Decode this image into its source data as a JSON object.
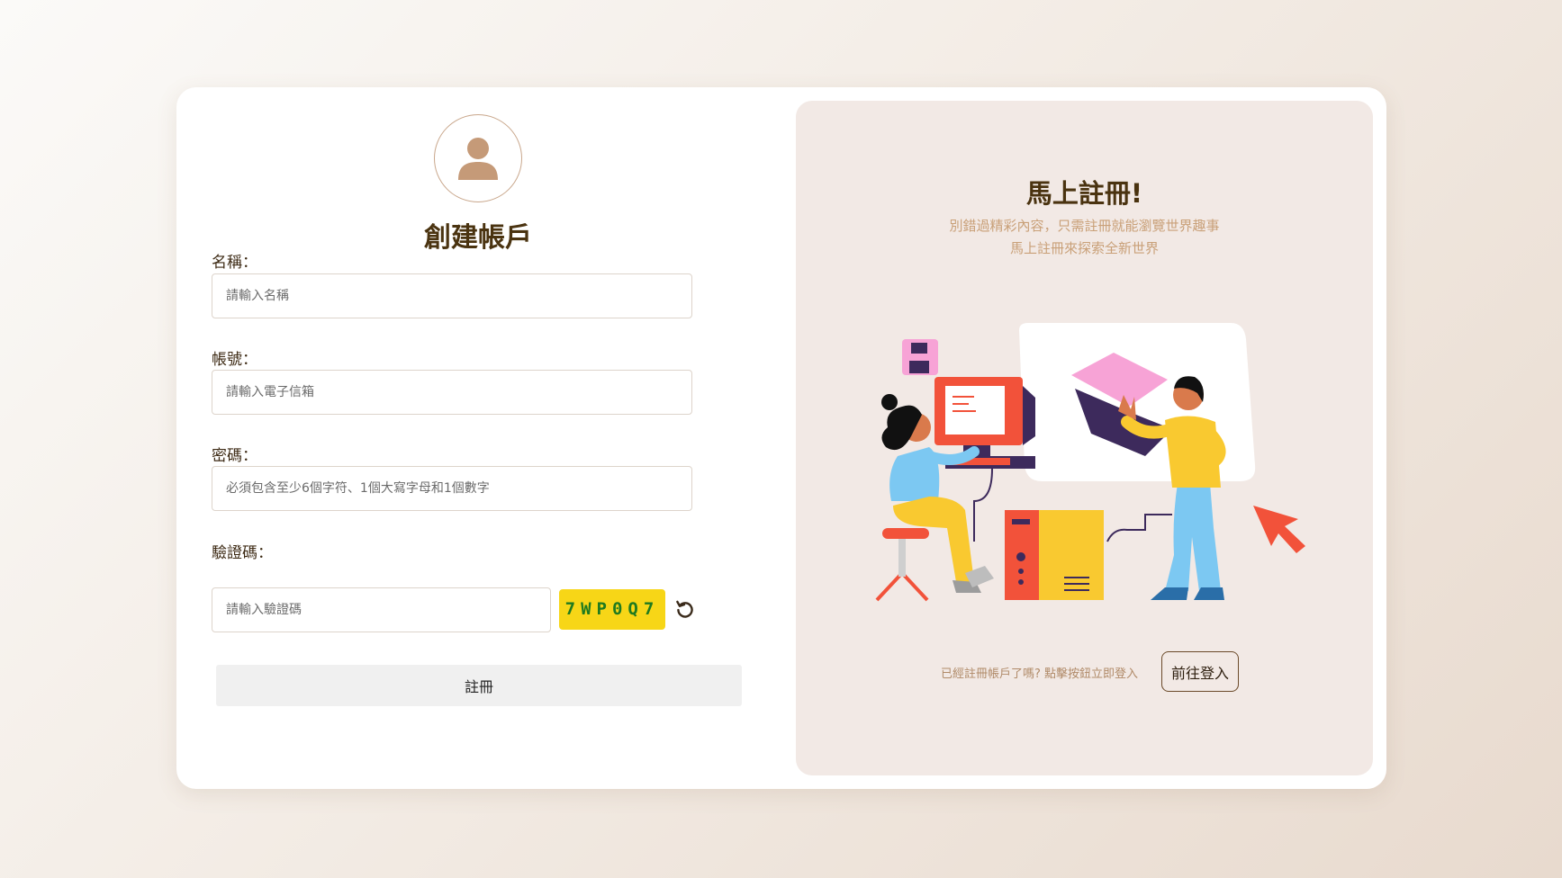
{
  "register": {
    "title": "創建帳戶",
    "fields": {
      "name": {
        "label": "名稱：",
        "placeholder": "請輸入名稱",
        "value": ""
      },
      "account": {
        "label": "帳號：",
        "placeholder": "請輸入電子信箱",
        "value": ""
      },
      "password": {
        "label": "密碼：",
        "placeholder": "必須包含至少6個字符、1個大寫字母和1個數字",
        "value": ""
      },
      "captcha": {
        "label": "驗證碼：",
        "placeholder": "請輸入驗證碼",
        "value": "",
        "code": "7WP0Q7"
      }
    },
    "submit_label": "註冊"
  },
  "promo": {
    "title": "馬上註冊!",
    "subtitle_line1": "別錯過精彩內容，只需註冊就能瀏覽世界趣事",
    "subtitle_line2": "馬上註冊來探索全新世界",
    "login_prompt": "已經註冊帳戶了嗎? 點擊按鈕立即登入",
    "login_button": "前往登入"
  },
  "colors": {
    "title_brown": "#4a3310",
    "subtitle_tan": "#c9a078",
    "captcha_bg": "#f7d617",
    "captcha_text": "#1f7a1f",
    "panel_bg": "#f2e9e5",
    "avatar_icon": "#c59a78"
  },
  "icons": {
    "avatar": "user-icon",
    "refresh": "refresh-icon",
    "illustration": "people-working-at-computer-illustration"
  }
}
